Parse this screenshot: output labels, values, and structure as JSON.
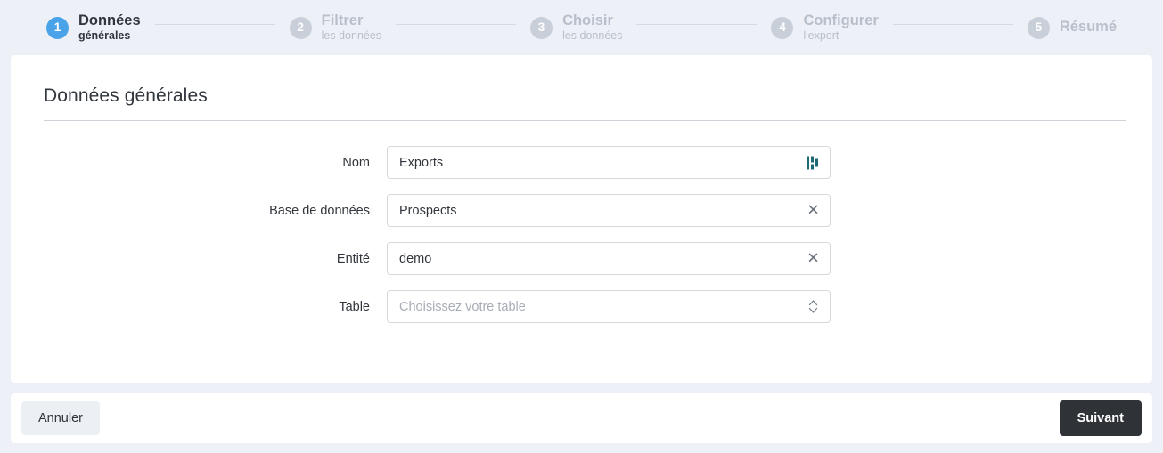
{
  "stepper": {
    "steps": [
      {
        "num": "1",
        "title": "Données",
        "sub": "générales",
        "state": "active"
      },
      {
        "num": "2",
        "title": "Filtrer",
        "sub": "les données",
        "state": "inactive"
      },
      {
        "num": "3",
        "title": "Choisir",
        "sub": "les données",
        "state": "inactive"
      },
      {
        "num": "4",
        "title": "Configurer",
        "sub": "l'export",
        "state": "inactive"
      },
      {
        "num": "5",
        "title": "Résumé",
        "sub": "",
        "state": "inactive"
      }
    ],
    "active_color": "#4aa3e8",
    "inactive_color": "#c9cfd9"
  },
  "card": {
    "title": "Données générales"
  },
  "form": {
    "fields": [
      {
        "label": "Nom",
        "value": "Exports",
        "placeholder": "",
        "icon": "bar-chart-icon",
        "icon_color": "#1f6b75"
      },
      {
        "label": "Base de données",
        "value": "Prospects",
        "placeholder": "",
        "icon": "clear-icon",
        "icon_glyph": "✕"
      },
      {
        "label": "Entité",
        "value": "demo",
        "placeholder": "",
        "icon": "clear-icon",
        "icon_glyph": "✕"
      },
      {
        "label": "Table",
        "value": "",
        "placeholder": "Choisissez votre table",
        "icon": "chevron-up-down-icon"
      }
    ]
  },
  "footer": {
    "cancel_label": "Annuler",
    "next_label": "Suivant",
    "next_bg": "#2f3236"
  }
}
